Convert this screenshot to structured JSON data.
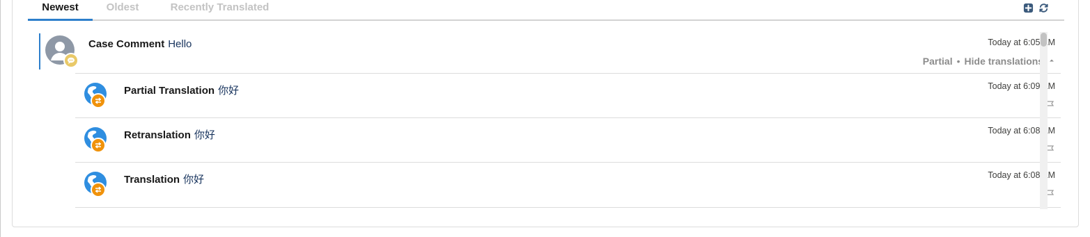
{
  "tabs": [
    {
      "label": "Newest"
    },
    {
      "label": "Oldest"
    },
    {
      "label": "Recently Translated"
    }
  ],
  "toolbar": {
    "add_icon": "add-square-icon",
    "refresh_icon": "refresh-icon"
  },
  "main_item": {
    "type_label": "Case Comment",
    "body": "Hello",
    "timestamp": "Today at 6:05 AM",
    "status": "Partial",
    "separator": "•",
    "toggle_label": "Hide translations",
    "toggle_icon": "caret-up-icon"
  },
  "translations": [
    {
      "type_label": "Partial Translation",
      "body": "你好",
      "timestamp": "Today at 6:09 AM"
    },
    {
      "type_label": "Retranslation",
      "body": "你好",
      "timestamp": "Today at 6:08 AM"
    },
    {
      "type_label": "Translation",
      "body": "你好",
      "timestamp": "Today at 6:08 AM"
    }
  ],
  "colors": {
    "accent": "#2d7fcb",
    "badge_yellow": "#e9c968",
    "badge_orange": "#f0920b",
    "globe_blue": "#2f8ee0",
    "avatar_gray": "#8e98a6"
  }
}
